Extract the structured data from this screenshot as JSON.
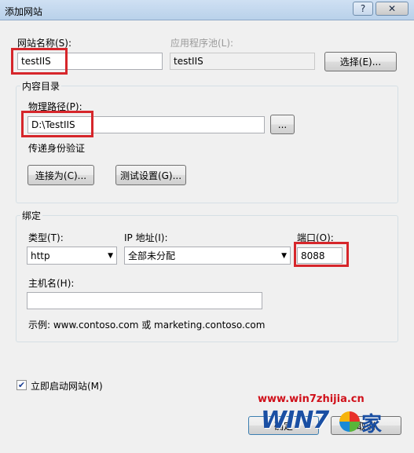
{
  "window": {
    "title": "添加网站",
    "help_glyph": "?",
    "close_glyph": "✕"
  },
  "site_name": {
    "label": "网站名称(S):",
    "value": "testIIS"
  },
  "app_pool": {
    "label": "应用程序池(L):",
    "value": "testIIS",
    "select_button": "选择(E)..."
  },
  "content_dir": {
    "group_title": "内容目录",
    "physical_path_label": "物理路径(P):",
    "physical_path_value": "D:\\TestIIS",
    "browse_button": "...",
    "pass_through_label": "传递身份验证",
    "connect_as_button": "连接为(C)...",
    "test_settings_button": "测试设置(G)..."
  },
  "binding": {
    "group_title": "绑定",
    "type_label": "类型(T):",
    "type_value": "http",
    "ip_label": "IP 地址(I):",
    "ip_value": "全部未分配",
    "port_label": "端口(O):",
    "port_value": "8088",
    "hostname_label": "主机名(H):",
    "hostname_value": "",
    "example_text": "示例: www.contoso.com 或 marketing.contoso.com"
  },
  "start_now": {
    "label": "立即启动网站(M)",
    "checked": true
  },
  "footer": {
    "ok_button": "确定",
    "cancel_button": "取消"
  },
  "watermark": {
    "url": "www.win7zhijia.cn",
    "logo_text": "WIN7",
    "logo_suffix": "家"
  },
  "colors": {
    "highlight": "#d6262b",
    "titlebar": "#b9d1ea"
  }
}
